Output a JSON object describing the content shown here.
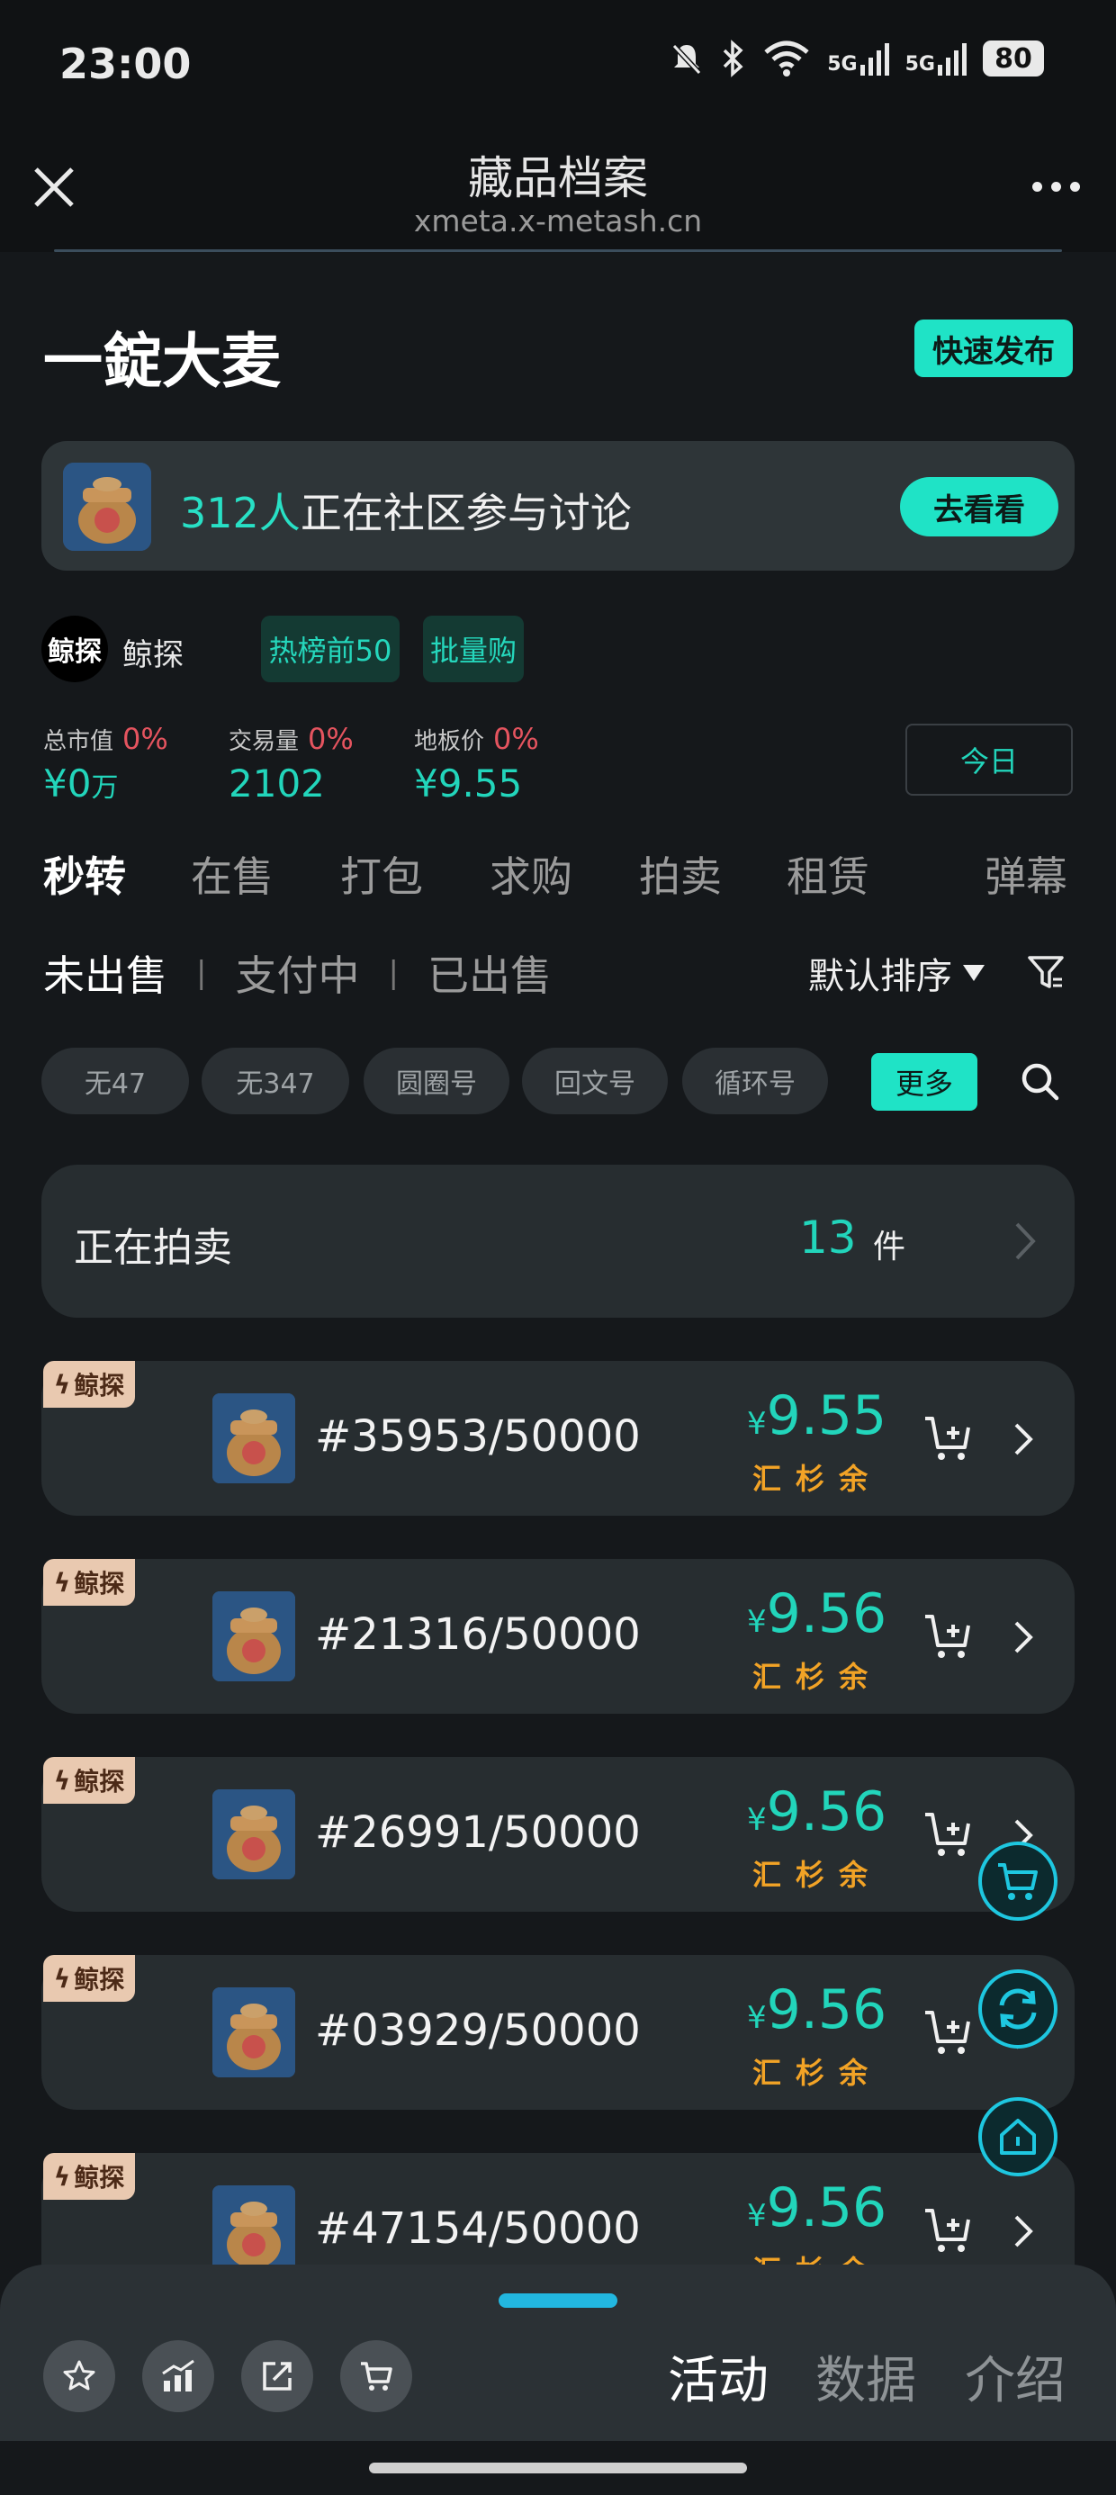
{
  "status_bar": {
    "time": "23:00",
    "battery": "80",
    "signal_1": "5G",
    "signal_2": "5G"
  },
  "header": {
    "title": "藏品档案",
    "url": "xmeta.x-metash.cn"
  },
  "page": {
    "title": "一錠大麦",
    "quick_publish": "快速发布"
  },
  "community": {
    "count": "312人",
    "text": "正在社区参与讨论",
    "button": "去看看"
  },
  "platform": {
    "logo": "鲸探",
    "name": "鲸探",
    "tags": [
      "热榜前50",
      "批量购"
    ]
  },
  "stats": [
    {
      "label": "总市值",
      "pct": "0%",
      "value": "¥0",
      "unit": "万"
    },
    {
      "label": "交易量",
      "pct": "0%",
      "value": "2102",
      "unit": ""
    },
    {
      "label": "地板价",
      "pct": "0%",
      "value": "¥9.55",
      "unit": ""
    }
  ],
  "today_button": "今日",
  "main_tabs": [
    "秒转",
    "在售",
    "打包",
    "求购",
    "拍卖",
    "租赁",
    "弹幕"
  ],
  "sub_tabs": [
    "未出售",
    "支付中",
    "已出售"
  ],
  "sort_label": "默认排序",
  "chips": [
    "无47",
    "无347",
    "圆圈号",
    "回文号",
    "循环号"
  ],
  "more_chip": "更多",
  "auction": {
    "label": "正在拍卖",
    "count": "13",
    "unit": "件"
  },
  "listings": [
    {
      "badge": "鲸探",
      "serial": "#35953/50000",
      "currency": "¥",
      "price": "9.55",
      "payment": "汇杉余"
    },
    {
      "badge": "鲸探",
      "serial": "#21316/50000",
      "currency": "¥",
      "price": "9.56",
      "payment": "汇杉余"
    },
    {
      "badge": "鲸探",
      "serial": "#26991/50000",
      "currency": "¥",
      "price": "9.56",
      "payment": "汇杉余"
    },
    {
      "badge": "鲸探",
      "serial": "#03929/50000",
      "currency": "¥",
      "price": "9.56",
      "payment": "汇杉余"
    },
    {
      "badge": "鲸探",
      "serial": "#47154/50000",
      "currency": "¥",
      "price": "9.56",
      "payment": "汇杉余"
    }
  ],
  "bottom_tabs": [
    "活动",
    "数据",
    "介绍"
  ],
  "colors": {
    "accent": "#1fe3c6",
    "price": "#22d5bb",
    "pct": "#e5545f",
    "payment": "#f2a326"
  }
}
